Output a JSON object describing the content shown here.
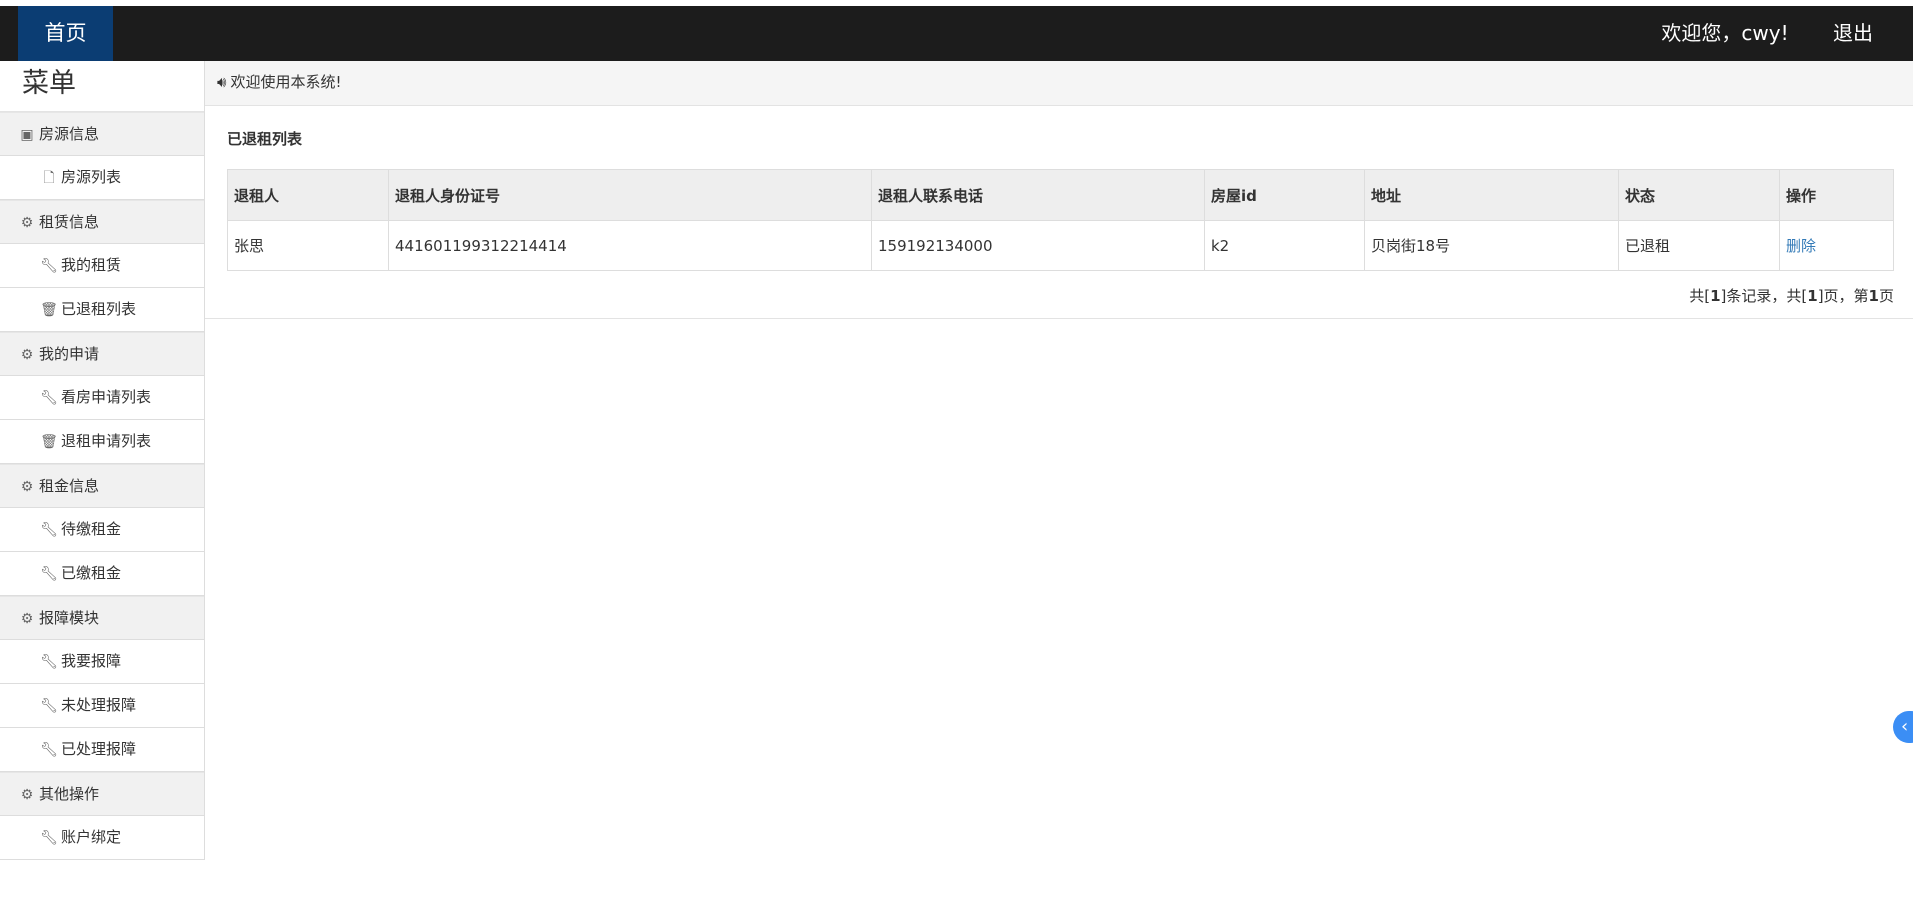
{
  "topbar": {
    "home_label": "首页",
    "welcome_text": "欢迎您，cwy!",
    "logout_label": "退出"
  },
  "sidebar": {
    "title": "菜单",
    "groups": [
      {
        "label": "房源信息",
        "icon": "building-icon",
        "items": [
          {
            "label": "房源列表",
            "icon": "file-icon"
          }
        ]
      },
      {
        "label": "租赁信息",
        "icon": "gear-icon",
        "items": [
          {
            "label": "我的租赁",
            "icon": "wrench-icon"
          },
          {
            "label": "已退租列表",
            "icon": "trash-icon"
          }
        ]
      },
      {
        "label": "我的申请",
        "icon": "gear-icon",
        "items": [
          {
            "label": "看房申请列表",
            "icon": "wrench-icon"
          },
          {
            "label": "退租申请列表",
            "icon": "trash-icon"
          }
        ]
      },
      {
        "label": "租金信息",
        "icon": "gear-icon",
        "items": [
          {
            "label": "待缴租金",
            "icon": "wrench-icon"
          },
          {
            "label": "已缴租金",
            "icon": "wrench-icon"
          }
        ]
      },
      {
        "label": "报障模块",
        "icon": "gear-icon",
        "items": [
          {
            "label": "我要报障",
            "icon": "wrench-icon"
          },
          {
            "label": "未处理报障",
            "icon": "wrench-icon"
          },
          {
            "label": "已处理报障",
            "icon": "wrench-icon"
          }
        ]
      },
      {
        "label": "其他操作",
        "icon": "gear-icon",
        "items": [
          {
            "label": "账户绑定",
            "icon": "wrench-icon"
          }
        ]
      }
    ]
  },
  "notice": {
    "icon": "speaker-icon",
    "text": "欢迎使用本系统!"
  },
  "panel": {
    "title": "已退租列表"
  },
  "table": {
    "headers": [
      "退租人",
      "退租人身份证号",
      "退租人联系电话",
      "房屋id",
      "地址",
      "状态",
      "操作"
    ],
    "rows": [
      {
        "name": "张思",
        "id_number": "441601199312214414",
        "phone": "159192134000",
        "house_id": "k2",
        "address": "贝岗街18号",
        "status": "已退租",
        "action": "删除"
      }
    ]
  },
  "pager": {
    "prefix": "共[",
    "total_records": "1",
    "mid1": "]条记录，共[",
    "total_pages": "1",
    "mid2": "]页，第",
    "current_page": "1",
    "suffix": "页"
  },
  "side_toggle": {
    "glyph": "‹",
    "icon": "chevron-left-icon"
  },
  "colors": {
    "topbar_bg": "#1c1c1c",
    "home_bg": "#0b3d73",
    "link": "#337ab7",
    "toggle_bg": "#3b8ef5"
  }
}
